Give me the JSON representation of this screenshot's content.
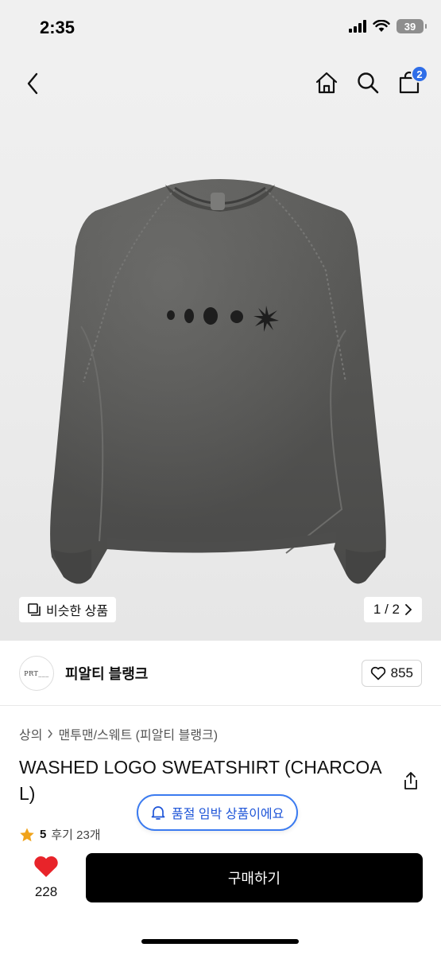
{
  "status_bar": {
    "time": "2:35",
    "battery": "39"
  },
  "nav": {
    "cart_count": "2"
  },
  "gallery": {
    "similar_label": "비슷한 상품",
    "pager": "1 / 2"
  },
  "brand": {
    "logo_text": "PRT___",
    "name": "피알티 블랭크",
    "like_count": "855"
  },
  "breadcrumb": {
    "level1": "상의",
    "level2": "맨투맨/스웨트 (피알티 블랭크)"
  },
  "product": {
    "title": "WASHED LOGO SWEATSHIRT (CHARCOAL)"
  },
  "stock_notice": "품절 임박 상품이에요",
  "rating": {
    "score": "5",
    "reviews": "후기 23개"
  },
  "bottom": {
    "wish_count": "228",
    "buy_label": "구매하기"
  },
  "colors": {
    "accent": "#2f6ee8",
    "heart": "#e8242a",
    "garment": "#5a5a58"
  },
  "icons": [
    "back-icon",
    "home-icon",
    "search-icon",
    "cart-icon",
    "similar-icon",
    "chevron-right-icon",
    "heart-outline-icon",
    "share-icon",
    "bell-icon",
    "star-icon",
    "heart-filled-icon"
  ]
}
